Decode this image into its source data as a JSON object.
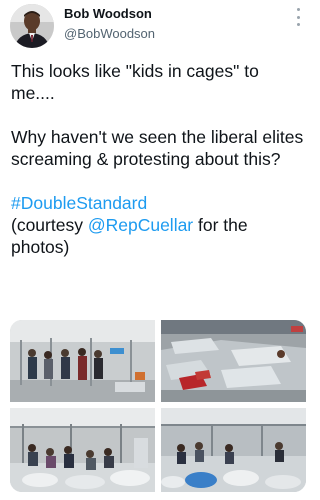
{
  "tweet": {
    "display_name": "Bob Woodson",
    "handle": "@BobWoodson",
    "lines": {
      "line1": "This looks like \"kids in cages\" to me....",
      "line2": "Why haven't we seen the liberal elites screaming & protesting about this?",
      "hashtag": "#DoubleStandard",
      "courtesy_prefix": "(courtesy ",
      "mention": "@RepCuellar",
      "courtesy_suffix": " for the photos)"
    }
  },
  "icons": {
    "avatar": "profile-photo",
    "more": "more-options-icon"
  },
  "colors": {
    "link": "#1d9bf0",
    "text": "#0f1419",
    "secondary": "#536471"
  },
  "media": {
    "photo_count": 4
  }
}
